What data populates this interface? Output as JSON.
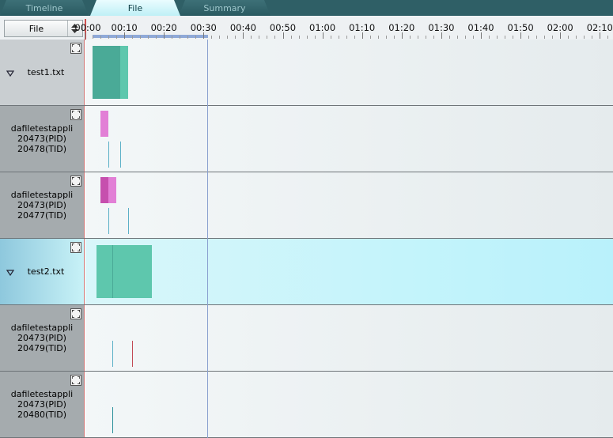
{
  "tabs": [
    {
      "label": "Timeline",
      "active": false
    },
    {
      "label": "File",
      "active": true
    },
    {
      "label": "Summary",
      "active": false
    }
  ],
  "header": {
    "combo_value": "File",
    "ticks": [
      "00:00",
      "00:10",
      "00:20",
      "00:30",
      "00:40",
      "00:50",
      "01:00",
      "01:10",
      "01:20",
      "01:30",
      "01:40",
      "01:50",
      "02:00",
      "02:10"
    ]
  },
  "rows": [
    {
      "kind": "file",
      "name": "test1.txt",
      "selected": false
    },
    {
      "kind": "thread",
      "process": "dafiletestappli",
      "pid": "20473(PID)",
      "tid": "20478(TID)"
    },
    {
      "kind": "thread",
      "process": "dafiletestappli",
      "pid": "20473(PID)",
      "tid": "20477(TID)"
    },
    {
      "kind": "file",
      "name": "test2.txt",
      "selected": true
    },
    {
      "kind": "thread",
      "process": "dafiletestappli",
      "pid": "20473(PID)",
      "tid": "20479(TID)"
    },
    {
      "kind": "thread",
      "process": "dafiletestappli",
      "pid": "20473(PID)",
      "tid": "20480(TID)"
    }
  ],
  "colors": {
    "open": "#4aaa97",
    "read": "#5ec7ad",
    "write": "#e27fd6",
    "write_dark": "#c64fae",
    "thread_line": "#5bb0c7",
    "thread_line_red": "#c24a55"
  }
}
